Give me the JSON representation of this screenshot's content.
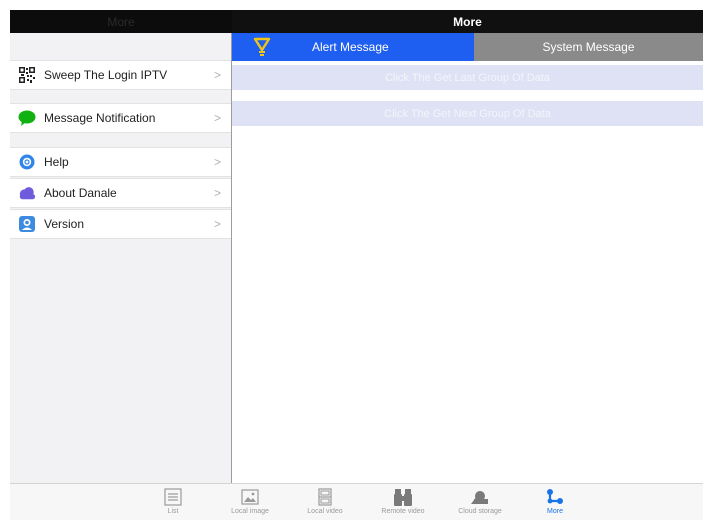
{
  "window": {
    "left_title": "More",
    "right_title": "More"
  },
  "sidebar": {
    "items": [
      {
        "label": "Sweep The Login IPTV",
        "icon": "qr-code-icon"
      },
      {
        "label": "Message Notification",
        "icon": "speech-bubble-icon"
      },
      {
        "label": "Help",
        "icon": "lifebuoy-icon"
      },
      {
        "label": "About Danale",
        "icon": "cloud-icon"
      },
      {
        "label": "Version",
        "icon": "version-icon"
      }
    ],
    "chevron": ">"
  },
  "tabs": {
    "alert_label": "Alert Message",
    "system_label": "System Message",
    "active": "Alert Message"
  },
  "actions": {
    "last_group": "Click The Get Last Group Of Data",
    "next_group": "Click The Get Next Group Of Data"
  },
  "tabbar": {
    "items": [
      {
        "label": "List",
        "icon": "list-icon"
      },
      {
        "label": "Local image",
        "icon": "image-icon"
      },
      {
        "label": "Local video",
        "icon": "film-icon"
      },
      {
        "label": "Remote video",
        "icon": "binoculars-icon"
      },
      {
        "label": "Cloud storage",
        "icon": "cloud-storage-icon"
      },
      {
        "label": "More",
        "icon": "more-icon"
      }
    ],
    "active": "More"
  },
  "colors": {
    "accent": "#1e5ef0",
    "active_tab_label": "#1a73e8",
    "inactive_tab": "#8a8a8a"
  }
}
